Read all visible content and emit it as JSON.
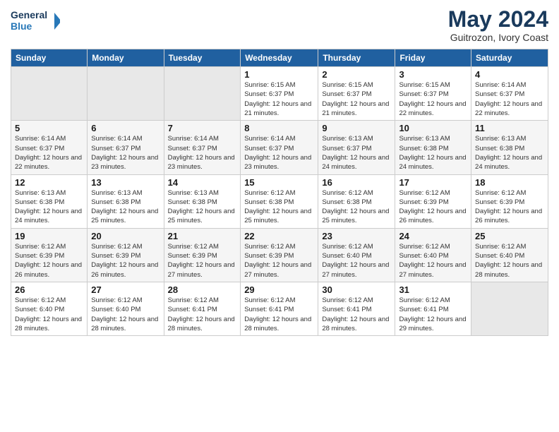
{
  "logo": {
    "line1": "General",
    "line2": "Blue"
  },
  "title": "May 2024",
  "location": "Guitrozon, Ivory Coast",
  "weekdays": [
    "Sunday",
    "Monday",
    "Tuesday",
    "Wednesday",
    "Thursday",
    "Friday",
    "Saturday"
  ],
  "weeks": [
    [
      {
        "day": "",
        "info": ""
      },
      {
        "day": "",
        "info": ""
      },
      {
        "day": "",
        "info": ""
      },
      {
        "day": "1",
        "info": "Sunrise: 6:15 AM\nSunset: 6:37 PM\nDaylight: 12 hours and 21 minutes."
      },
      {
        "day": "2",
        "info": "Sunrise: 6:15 AM\nSunset: 6:37 PM\nDaylight: 12 hours and 21 minutes."
      },
      {
        "day": "3",
        "info": "Sunrise: 6:15 AM\nSunset: 6:37 PM\nDaylight: 12 hours and 22 minutes."
      },
      {
        "day": "4",
        "info": "Sunrise: 6:14 AM\nSunset: 6:37 PM\nDaylight: 12 hours and 22 minutes."
      }
    ],
    [
      {
        "day": "5",
        "info": "Sunrise: 6:14 AM\nSunset: 6:37 PM\nDaylight: 12 hours and 22 minutes."
      },
      {
        "day": "6",
        "info": "Sunrise: 6:14 AM\nSunset: 6:37 PM\nDaylight: 12 hours and 23 minutes."
      },
      {
        "day": "7",
        "info": "Sunrise: 6:14 AM\nSunset: 6:37 PM\nDaylight: 12 hours and 23 minutes."
      },
      {
        "day": "8",
        "info": "Sunrise: 6:14 AM\nSunset: 6:37 PM\nDaylight: 12 hours and 23 minutes."
      },
      {
        "day": "9",
        "info": "Sunrise: 6:13 AM\nSunset: 6:37 PM\nDaylight: 12 hours and 24 minutes."
      },
      {
        "day": "10",
        "info": "Sunrise: 6:13 AM\nSunset: 6:38 PM\nDaylight: 12 hours and 24 minutes."
      },
      {
        "day": "11",
        "info": "Sunrise: 6:13 AM\nSunset: 6:38 PM\nDaylight: 12 hours and 24 minutes."
      }
    ],
    [
      {
        "day": "12",
        "info": "Sunrise: 6:13 AM\nSunset: 6:38 PM\nDaylight: 12 hours and 24 minutes."
      },
      {
        "day": "13",
        "info": "Sunrise: 6:13 AM\nSunset: 6:38 PM\nDaylight: 12 hours and 25 minutes."
      },
      {
        "day": "14",
        "info": "Sunrise: 6:13 AM\nSunset: 6:38 PM\nDaylight: 12 hours and 25 minutes."
      },
      {
        "day": "15",
        "info": "Sunrise: 6:12 AM\nSunset: 6:38 PM\nDaylight: 12 hours and 25 minutes."
      },
      {
        "day": "16",
        "info": "Sunrise: 6:12 AM\nSunset: 6:38 PM\nDaylight: 12 hours and 25 minutes."
      },
      {
        "day": "17",
        "info": "Sunrise: 6:12 AM\nSunset: 6:39 PM\nDaylight: 12 hours and 26 minutes."
      },
      {
        "day": "18",
        "info": "Sunrise: 6:12 AM\nSunset: 6:39 PM\nDaylight: 12 hours and 26 minutes."
      }
    ],
    [
      {
        "day": "19",
        "info": "Sunrise: 6:12 AM\nSunset: 6:39 PM\nDaylight: 12 hours and 26 minutes."
      },
      {
        "day": "20",
        "info": "Sunrise: 6:12 AM\nSunset: 6:39 PM\nDaylight: 12 hours and 26 minutes."
      },
      {
        "day": "21",
        "info": "Sunrise: 6:12 AM\nSunset: 6:39 PM\nDaylight: 12 hours and 27 minutes."
      },
      {
        "day": "22",
        "info": "Sunrise: 6:12 AM\nSunset: 6:39 PM\nDaylight: 12 hours and 27 minutes."
      },
      {
        "day": "23",
        "info": "Sunrise: 6:12 AM\nSunset: 6:40 PM\nDaylight: 12 hours and 27 minutes."
      },
      {
        "day": "24",
        "info": "Sunrise: 6:12 AM\nSunset: 6:40 PM\nDaylight: 12 hours and 27 minutes."
      },
      {
        "day": "25",
        "info": "Sunrise: 6:12 AM\nSunset: 6:40 PM\nDaylight: 12 hours and 28 minutes."
      }
    ],
    [
      {
        "day": "26",
        "info": "Sunrise: 6:12 AM\nSunset: 6:40 PM\nDaylight: 12 hours and 28 minutes."
      },
      {
        "day": "27",
        "info": "Sunrise: 6:12 AM\nSunset: 6:40 PM\nDaylight: 12 hours and 28 minutes."
      },
      {
        "day": "28",
        "info": "Sunrise: 6:12 AM\nSunset: 6:41 PM\nDaylight: 12 hours and 28 minutes."
      },
      {
        "day": "29",
        "info": "Sunrise: 6:12 AM\nSunset: 6:41 PM\nDaylight: 12 hours and 28 minutes."
      },
      {
        "day": "30",
        "info": "Sunrise: 6:12 AM\nSunset: 6:41 PM\nDaylight: 12 hours and 28 minutes."
      },
      {
        "day": "31",
        "info": "Sunrise: 6:12 AM\nSunset: 6:41 PM\nDaylight: 12 hours and 29 minutes."
      },
      {
        "day": "",
        "info": ""
      }
    ]
  ]
}
